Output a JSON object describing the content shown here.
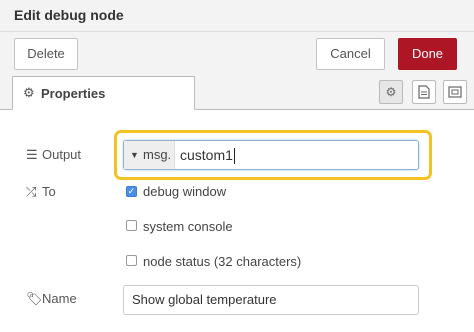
{
  "tray": {
    "title": "Edit debug node"
  },
  "toolbar": {
    "delete_label": "Delete",
    "cancel_label": "Cancel",
    "done_label": "Done",
    "done_color": "#ad1625"
  },
  "tabs": {
    "properties_label": "Properties",
    "icons": [
      "gear-icon",
      "description-icon",
      "appearance-icon"
    ]
  },
  "form": {
    "output": {
      "label": "Output",
      "prefix": "msg.",
      "value": "custom1",
      "highlight_color": "#f4c321"
    },
    "to": {
      "label": "To",
      "options": [
        {
          "label": "debug window",
          "checked": true
        },
        {
          "label": "system console",
          "checked": false
        },
        {
          "label": "node status (32 characters)",
          "checked": false
        }
      ]
    },
    "name": {
      "label": "Name",
      "value": "Show global temperature"
    }
  }
}
